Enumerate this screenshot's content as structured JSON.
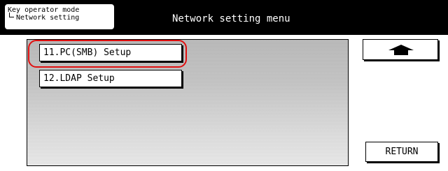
{
  "header": {
    "breadcrumb": [
      "Key operator mode",
      "Network setting"
    ],
    "title": "Network setting menu"
  },
  "menu": {
    "items": [
      {
        "label": "11.PC(SMB) Setup",
        "highlighted": true
      },
      {
        "label": "12.LDAP Setup",
        "highlighted": false
      }
    ],
    "highlight_color": "#e01010"
  },
  "nav": {
    "up_icon": "up-arrow-icon",
    "return_label": "RETURN"
  }
}
